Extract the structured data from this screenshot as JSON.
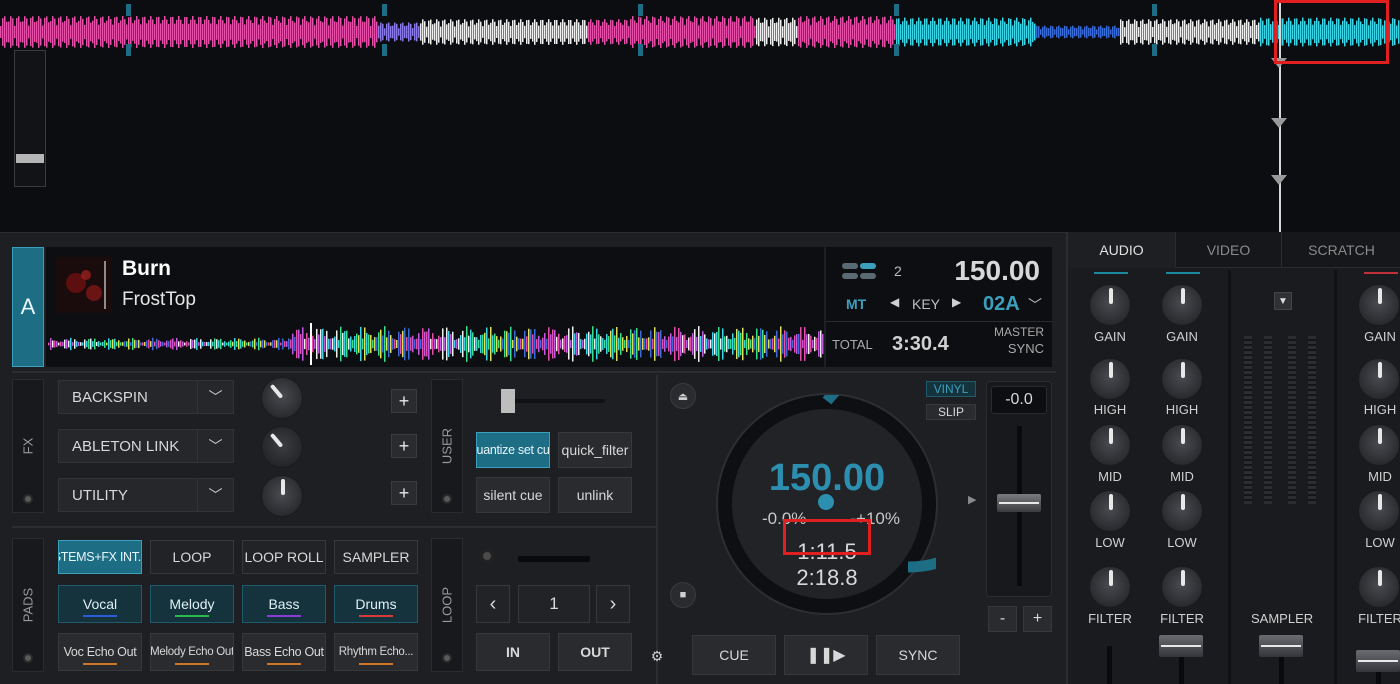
{
  "deck": {
    "letter": "A",
    "track": {
      "title": "Burn",
      "artist": "FrostTop"
    },
    "info": {
      "deck_number": "2",
      "bpm": "150.00",
      "mt": "MT",
      "key_label": "KEY",
      "key_value": "02A",
      "total_label": "TOTAL",
      "total_time": "3:30.4",
      "master_label": "MASTER",
      "sync_label": "SYNC"
    },
    "fx": {
      "section_label": "FX",
      "slots": [
        "BACKSPIN",
        "ABLETON LINK",
        "UTILITY"
      ],
      "add_label": "+"
    },
    "user": {
      "section_label": "USER",
      "buttons": [
        "quantize set cue",
        "quick_filter",
        "silent cue",
        "unlink"
      ]
    },
    "pads": {
      "section_label": "PADS",
      "modes": [
        "STEMS+FX INT...",
        "LOOP",
        "LOOP ROLL",
        "SAMPLER"
      ],
      "stems": [
        "Vocal",
        "Melody",
        "Bass",
        "Drums"
      ],
      "echo": [
        "Voc Echo Out",
        "Melody Echo Out",
        "Bass Echo Out",
        "Rhythm Echo..."
      ]
    },
    "loop": {
      "section_label": "LOOP",
      "prev": "‹",
      "size": "1",
      "next": "›",
      "in_label": "IN",
      "out_label": "OUT"
    },
    "jog": {
      "vinyl_label": "VINYL",
      "slip_label": "SLIP",
      "bpm": "150.00",
      "pitch_left": "-0.0%",
      "pitch_right": "-+10%",
      "elapsed": "1:11.5",
      "remaining": "2:18.8",
      "pitch_value": "-0.0",
      "minus": "-",
      "plus": "+"
    },
    "transport": {
      "cue_label": "CUE",
      "play_label": "❚❚▶",
      "sync_label": "SYNC"
    }
  },
  "mixer": {
    "tabs": [
      "AUDIO",
      "VIDEO",
      "SCRATCH"
    ],
    "eq_labels": [
      "GAIN",
      "HIGH",
      "MID",
      "LOW",
      "FILTER"
    ],
    "sampler_label": "SAMPLER"
  },
  "colors": {
    "accent": "#2d8fb0",
    "accent_border": "#3aa0bd",
    "highlight": "#e02020",
    "wave_pink": "#e64fa8",
    "wave_cyan": "#3ad6e8",
    "echo_bar": "#d0762a"
  },
  "icons": [
    "eject-icon",
    "stop-icon",
    "gear-icon",
    "play-pause-icon",
    "chevron-down-icon",
    "triangle-right-icon"
  ]
}
